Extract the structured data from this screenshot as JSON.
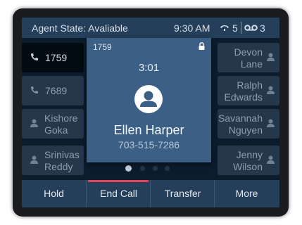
{
  "status": {
    "agent_state": "Agent State: Avaliable",
    "time": "9:30 AM",
    "active_calls": "5",
    "voicemail_count": "3",
    "icons": [
      "calls-icon",
      "voicemail-icon"
    ]
  },
  "left_lines": [
    {
      "label": "1759",
      "icon": "phone-icon",
      "active": true
    },
    {
      "label": "7689",
      "icon": "phone-icon",
      "active": false
    },
    {
      "label": "Kishore Goka",
      "line1": "Kishore",
      "line2": "Goka",
      "icon": "person-icon"
    },
    {
      "label": "Srinivas Reddy",
      "line1": "Srinivas",
      "line2": "Reddy",
      "icon": "person-icon"
    }
  ],
  "right_lines": [
    {
      "line1": "Devon",
      "line2": "Lane",
      "icon": "person-icon"
    },
    {
      "line1": "Ralph",
      "line2": "Edwards",
      "icon": "person-icon"
    },
    {
      "line1": "Savannah",
      "line2": "Nguyen",
      "icon": "person-icon"
    },
    {
      "line1": "Jenny",
      "line2": "Wilson",
      "icon": "person-icon"
    }
  ],
  "call_popup": {
    "line_number": "1759",
    "duration": "3:01",
    "caller_name": "Ellen Harper",
    "caller_number": "703-515-7286",
    "icons": [
      "lock-icon",
      "caller-avatar-icon"
    ]
  },
  "page_indicator": {
    "pages": 4,
    "current_page": 1
  },
  "softkeys": [
    {
      "label": "Hold"
    },
    {
      "label": "End Call",
      "highlighted": true,
      "highlight_color": "#e0435a"
    },
    {
      "label": "Transfer"
    },
    {
      "label": "More"
    }
  ],
  "colors": {
    "screen_bg": "#0b1c2c",
    "bar_bg": "#253e59",
    "line_key_bg": "#24374b",
    "popup_bg": "#3c5f86",
    "accent_red": "#e0435a"
  }
}
